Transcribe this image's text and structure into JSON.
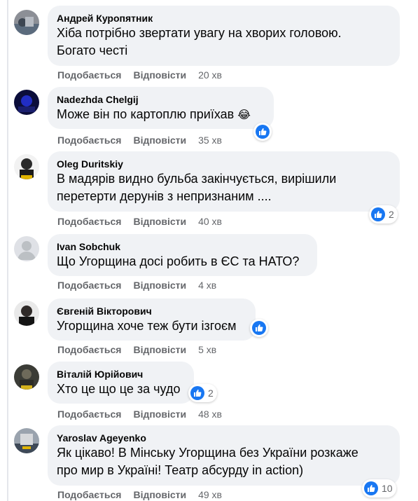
{
  "actions": {
    "like_label": "Подобається",
    "reply_label": "Відповісти"
  },
  "comments": [
    {
      "author": "Андрей Куропятник",
      "text": "Хіба потрібно звертати увагу на хворих головою.\nБогато честі",
      "time": "20 хв",
      "reactions": ""
    },
    {
      "author": "Nadezhda Chelgij",
      "text": "Може він по картоплю приїхав",
      "emoji": "😂",
      "time": "35 хв",
      "reactions": ""
    },
    {
      "author": "Oleg Duritskiy",
      "text": "В мадярів видно бульба закінчується, вирішили\nперетерти дерунів з непризнаним ....",
      "time": "40 хв",
      "reactions": "2"
    },
    {
      "author": "Ivan Sobchuk",
      "text": "Що Угорщина досі робить в ЄС та НАТО?",
      "time": "4 хв",
      "reactions": ""
    },
    {
      "author": "Євгеній Вікторович",
      "text": "Угорщина хоче теж бути ізгоєм",
      "time": "5 хв",
      "reactions": ""
    },
    {
      "author": "Віталій Юрійович",
      "text": "Хто це що це за чудо",
      "time": "48 хв",
      "reactions": "2"
    },
    {
      "author": "Yaroslav Ageyenko",
      "text": "Як цікаво! В Мінську Угорщина без України розкаже\nпро мир в Україні! Театр абсурду in action)",
      "time": "49 хв",
      "reactions": "10"
    }
  ],
  "colors": {
    "bubble": "#f0f2f5",
    "meta": "#65676b",
    "like": "#1877f2"
  }
}
